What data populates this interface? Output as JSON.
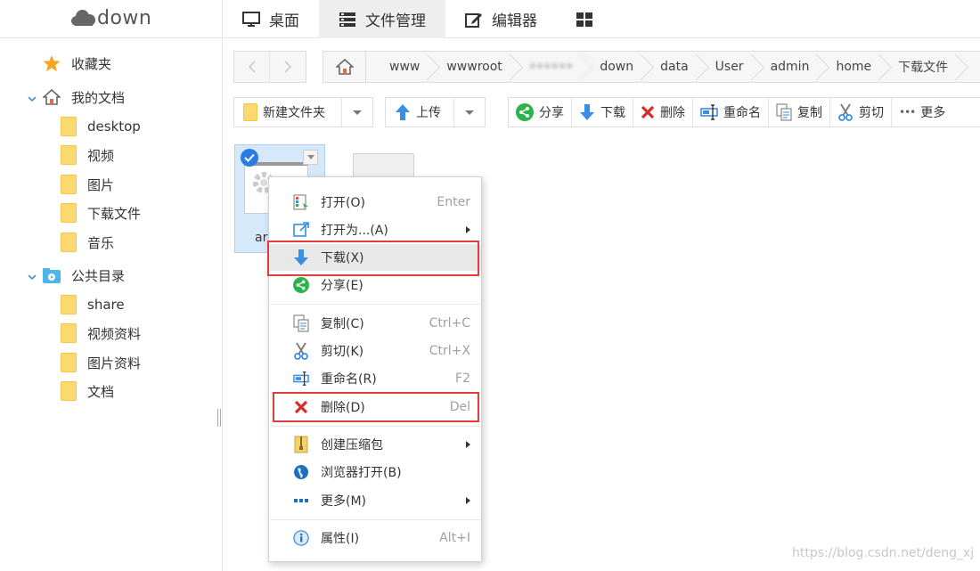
{
  "app": {
    "logo_text": "down",
    "tabs": [
      {
        "label": "桌面",
        "icon": "monitor-icon"
      },
      {
        "label": "文件管理",
        "icon": "drawer-icon"
      },
      {
        "label": "编辑器",
        "icon": "edit-icon"
      },
      {
        "label": "",
        "icon": "grid-icon"
      }
    ]
  },
  "sidebar": {
    "favorites_label": "收藏夹",
    "my_docs_label": "我的文档",
    "my_docs_items": [
      "desktop",
      "视频",
      "图片",
      "下载文件",
      "音乐"
    ],
    "public_label": "公共目录",
    "public_items": [
      "share",
      "视频资料",
      "图片资料",
      "文档"
    ]
  },
  "breadcrumb": {
    "items": [
      "www",
      "wwwroot",
      "••••••",
      "down",
      "data",
      "User",
      "admin",
      "home",
      "下载文件"
    ]
  },
  "toolbar": {
    "new_folder": "新建文件夹",
    "upload": "上传",
    "share": "分享",
    "download": "下载",
    "delete": "删除",
    "rename": "重命名",
    "copy": "复制",
    "cut": "剪切",
    "more": "更多"
  },
  "file": {
    "name": "ar"
  },
  "context_menu": {
    "items": [
      {
        "label": "打开(O)",
        "shortcut": "Enter",
        "icon": "open-icon"
      },
      {
        "label": "打开为...(A)",
        "shortcut": "",
        "icon": "open-as-icon",
        "submenu": true
      },
      {
        "label": "下载(X)",
        "shortcut": "",
        "icon": "download-icon"
      },
      {
        "label": "分享(E)",
        "shortcut": "",
        "icon": "share-icon"
      },
      {
        "label": "复制(C)",
        "shortcut": "Ctrl+C",
        "icon": "copy-icon"
      },
      {
        "label": "剪切(K)",
        "shortcut": "Ctrl+X",
        "icon": "scissors-icon"
      },
      {
        "label": "重命名(R)",
        "shortcut": "F2",
        "icon": "rename-icon"
      },
      {
        "label": "删除(D)",
        "shortcut": "Del",
        "icon": "delete-icon"
      },
      {
        "label": "创建压缩包",
        "shortcut": "",
        "icon": "zip-icon",
        "submenu": true
      },
      {
        "label": "浏览器打开(B)",
        "shortcut": "",
        "icon": "globe-icon"
      },
      {
        "label": "更多(M)",
        "shortcut": "",
        "icon": "more-icon",
        "submenu": true
      },
      {
        "label": "属性(I)",
        "shortcut": "Alt+I",
        "icon": "info-icon"
      }
    ]
  },
  "watermark": "https://blog.csdn.net/deng_xj",
  "colors": {
    "highlight_box": "#e03c3c",
    "folder": "#fbd970",
    "selected_bg": "#d6e9fb",
    "accent_blue": "#2a7be4"
  }
}
